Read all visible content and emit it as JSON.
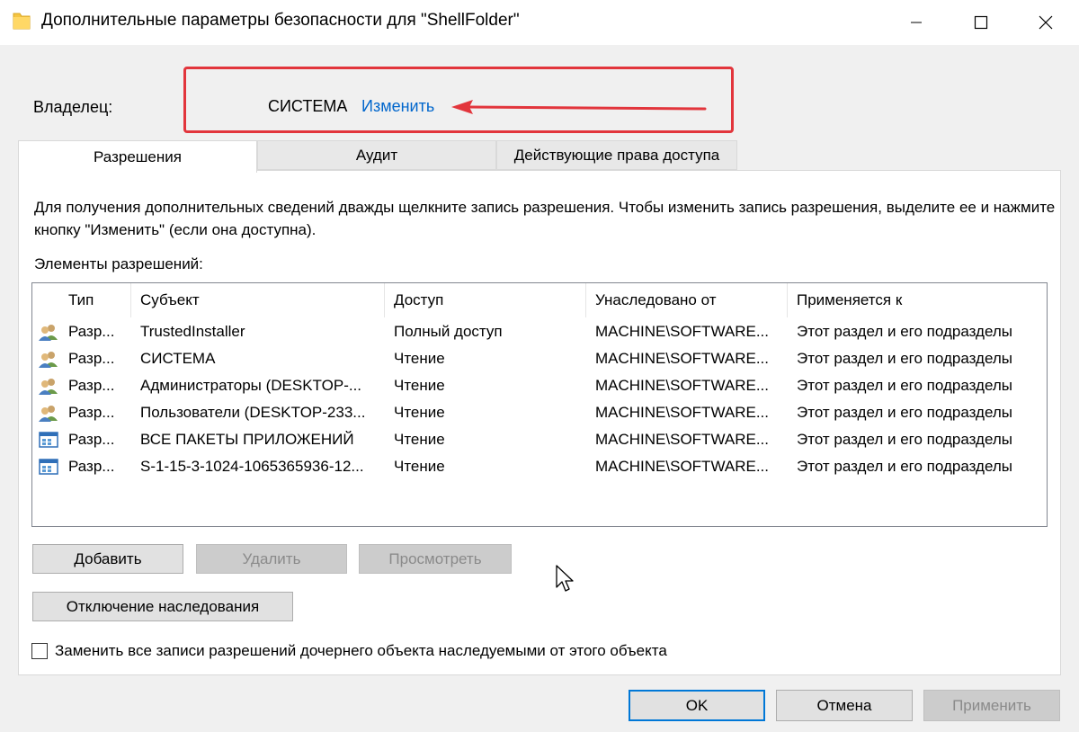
{
  "window": {
    "title": "Дополнительные параметры безопасности  для \"ShellFolder\""
  },
  "owner": {
    "label": "Владелец:",
    "value": "СИСТЕМА",
    "change_link": "Изменить"
  },
  "tabs": [
    {
      "label": "Разрешения",
      "active": true
    },
    {
      "label": "Аудит",
      "active": false
    },
    {
      "label": "Действующие права доступа",
      "active": false
    }
  ],
  "info_text": "Для получения дополнительных сведений дважды щелкните запись разрешения. Чтобы изменить запись разрешения, выделите ее и нажмите кнопку \"Изменить\" (если она доступна).",
  "elements_label": "Элементы разрешений:",
  "table": {
    "columns": [
      "Тип",
      "Субъект",
      "Доступ",
      "Унаследовано от",
      "Применяется к"
    ],
    "rows": [
      {
        "icon": "users-icon",
        "type": "Разр...",
        "subject": "TrustedInstaller",
        "access": "Полный доступ",
        "inherited": "MACHINE\\SOFTWARE...",
        "applies": "Этот раздел и его подразделы"
      },
      {
        "icon": "users-icon",
        "type": "Разр...",
        "subject": "СИСТЕМА",
        "access": "Чтение",
        "inherited": "MACHINE\\SOFTWARE...",
        "applies": "Этот раздел и его подразделы"
      },
      {
        "icon": "users-icon",
        "type": "Разр...",
        "subject": "Администраторы (DESKTOP-...",
        "access": "Чтение",
        "inherited": "MACHINE\\SOFTWARE...",
        "applies": "Этот раздел и его подразделы"
      },
      {
        "icon": "users-icon",
        "type": "Разр...",
        "subject": "Пользователи (DESKTOP-233...",
        "access": "Чтение",
        "inherited": "MACHINE\\SOFTWARE...",
        "applies": "Этот раздел и его подразделы"
      },
      {
        "icon": "app-package-icon",
        "type": "Разр...",
        "subject": "ВСЕ ПАКЕТЫ ПРИЛОЖЕНИЙ",
        "access": "Чтение",
        "inherited": "MACHINE\\SOFTWARE...",
        "applies": "Этот раздел и его подразделы"
      },
      {
        "icon": "app-package-icon",
        "type": "Разр...",
        "subject": "S-1-15-3-1024-1065365936-12...",
        "access": "Чтение",
        "inherited": "MACHINE\\SOFTWARE...",
        "applies": "Этот раздел и его подразделы"
      }
    ]
  },
  "buttons": {
    "add": "Добавить",
    "remove": "Удалить",
    "view": "Просмотреть",
    "disable_inheritance": "Отключение наследования",
    "ok": "OK",
    "cancel": "Отмена",
    "apply": "Применить"
  },
  "checkbox": {
    "label": "Заменить все записи разрешений дочернего объекта наследуемыми от этого объекта",
    "checked": false
  },
  "colors": {
    "link": "#0066cc",
    "highlight": "#e2353c",
    "accent": "#0078d7"
  }
}
